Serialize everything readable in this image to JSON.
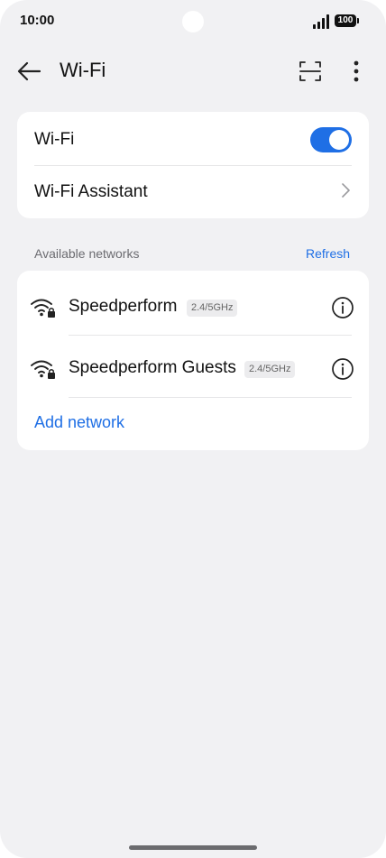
{
  "status_bar": {
    "time": "10:00",
    "battery": "100"
  },
  "header": {
    "title": "Wi-Fi",
    "back_icon": "arrow-left-icon",
    "scan_icon": "scan-qr-icon",
    "more_icon": "more-vertical-icon"
  },
  "wifi_card": {
    "wifi_label": "Wi-Fi",
    "wifi_enabled": true,
    "assistant_label": "Wi-Fi Assistant"
  },
  "networks_section": {
    "title": "Available networks",
    "refresh_label": "Refresh"
  },
  "networks": [
    {
      "name": "Speedperform",
      "band": "2.4/5GHz",
      "secured": true
    },
    {
      "name": "Speedperform Guests",
      "band": "2.4/5GHz",
      "secured": true
    }
  ],
  "add_network_label": "Add network",
  "colors": {
    "accent": "#1f6fe5",
    "background": "#f1f1f3",
    "card": "#ffffff",
    "text": "#111111",
    "secondary_text": "#6b6b70"
  }
}
